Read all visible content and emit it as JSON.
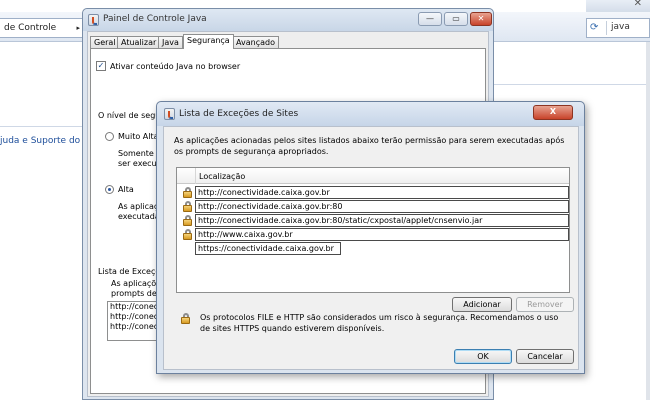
{
  "background": {
    "breadcrumb": "de Controle",
    "search_text": "java",
    "help_link": "juda e Suporte do W"
  },
  "java_control_panel": {
    "title": "Painel de Controle Java",
    "tabs": [
      "Geral",
      "Atualizar",
      "Java",
      "Segurança",
      "Avançado"
    ],
    "active_tab": "Segurança",
    "enable_java_label": "Ativar conteúdo Java no browser",
    "enable_java_checked": true,
    "security_level_label": "O nível de segur",
    "very_high_label": "Muito Alta",
    "very_high_desc_1": "Somente a",
    "very_high_desc_2": "ser execut",
    "high_label": "Alta",
    "high_desc_1": "As aplicaç",
    "high_desc_2": "executada",
    "exception_list_label": "Lista de Exceçõ",
    "exception_desc_1": "As aplicaçõ",
    "exception_desc_2": "prompts de s",
    "mini_list": [
      "http://conecti",
      "http://conecti",
      "http://conecti"
    ]
  },
  "exception_dialog": {
    "title": "Lista de Exceções de Sites",
    "close_label": "X",
    "description": "As aplicações acionadas pelos sites listados abaixo terão permissão para serem executadas após os prompts de segurança apropriados.",
    "column_header": "Localização",
    "rows": [
      {
        "url": "http://conectividade.caixa.gov.br"
      },
      {
        "url": "http://conectividade.caixa.gov.br:80"
      },
      {
        "url": "http://conectividade.caixa.gov.br:80/static/cxpostal/applet/cnsenvio.jar"
      },
      {
        "url": "http://www.caixa.gov.br"
      },
      {
        "url": "https://conectividade.caixa.gov.br"
      }
    ],
    "add_button": "Adicionar",
    "remove_button": "Remover",
    "warning": "Os protocolos FILE e HTTP são considerados um risco à segurança. Recomendamos o uso de sites HTTPS quando estiverem disponíveis.",
    "ok_button": "OK",
    "cancel_button": "Cancelar"
  }
}
